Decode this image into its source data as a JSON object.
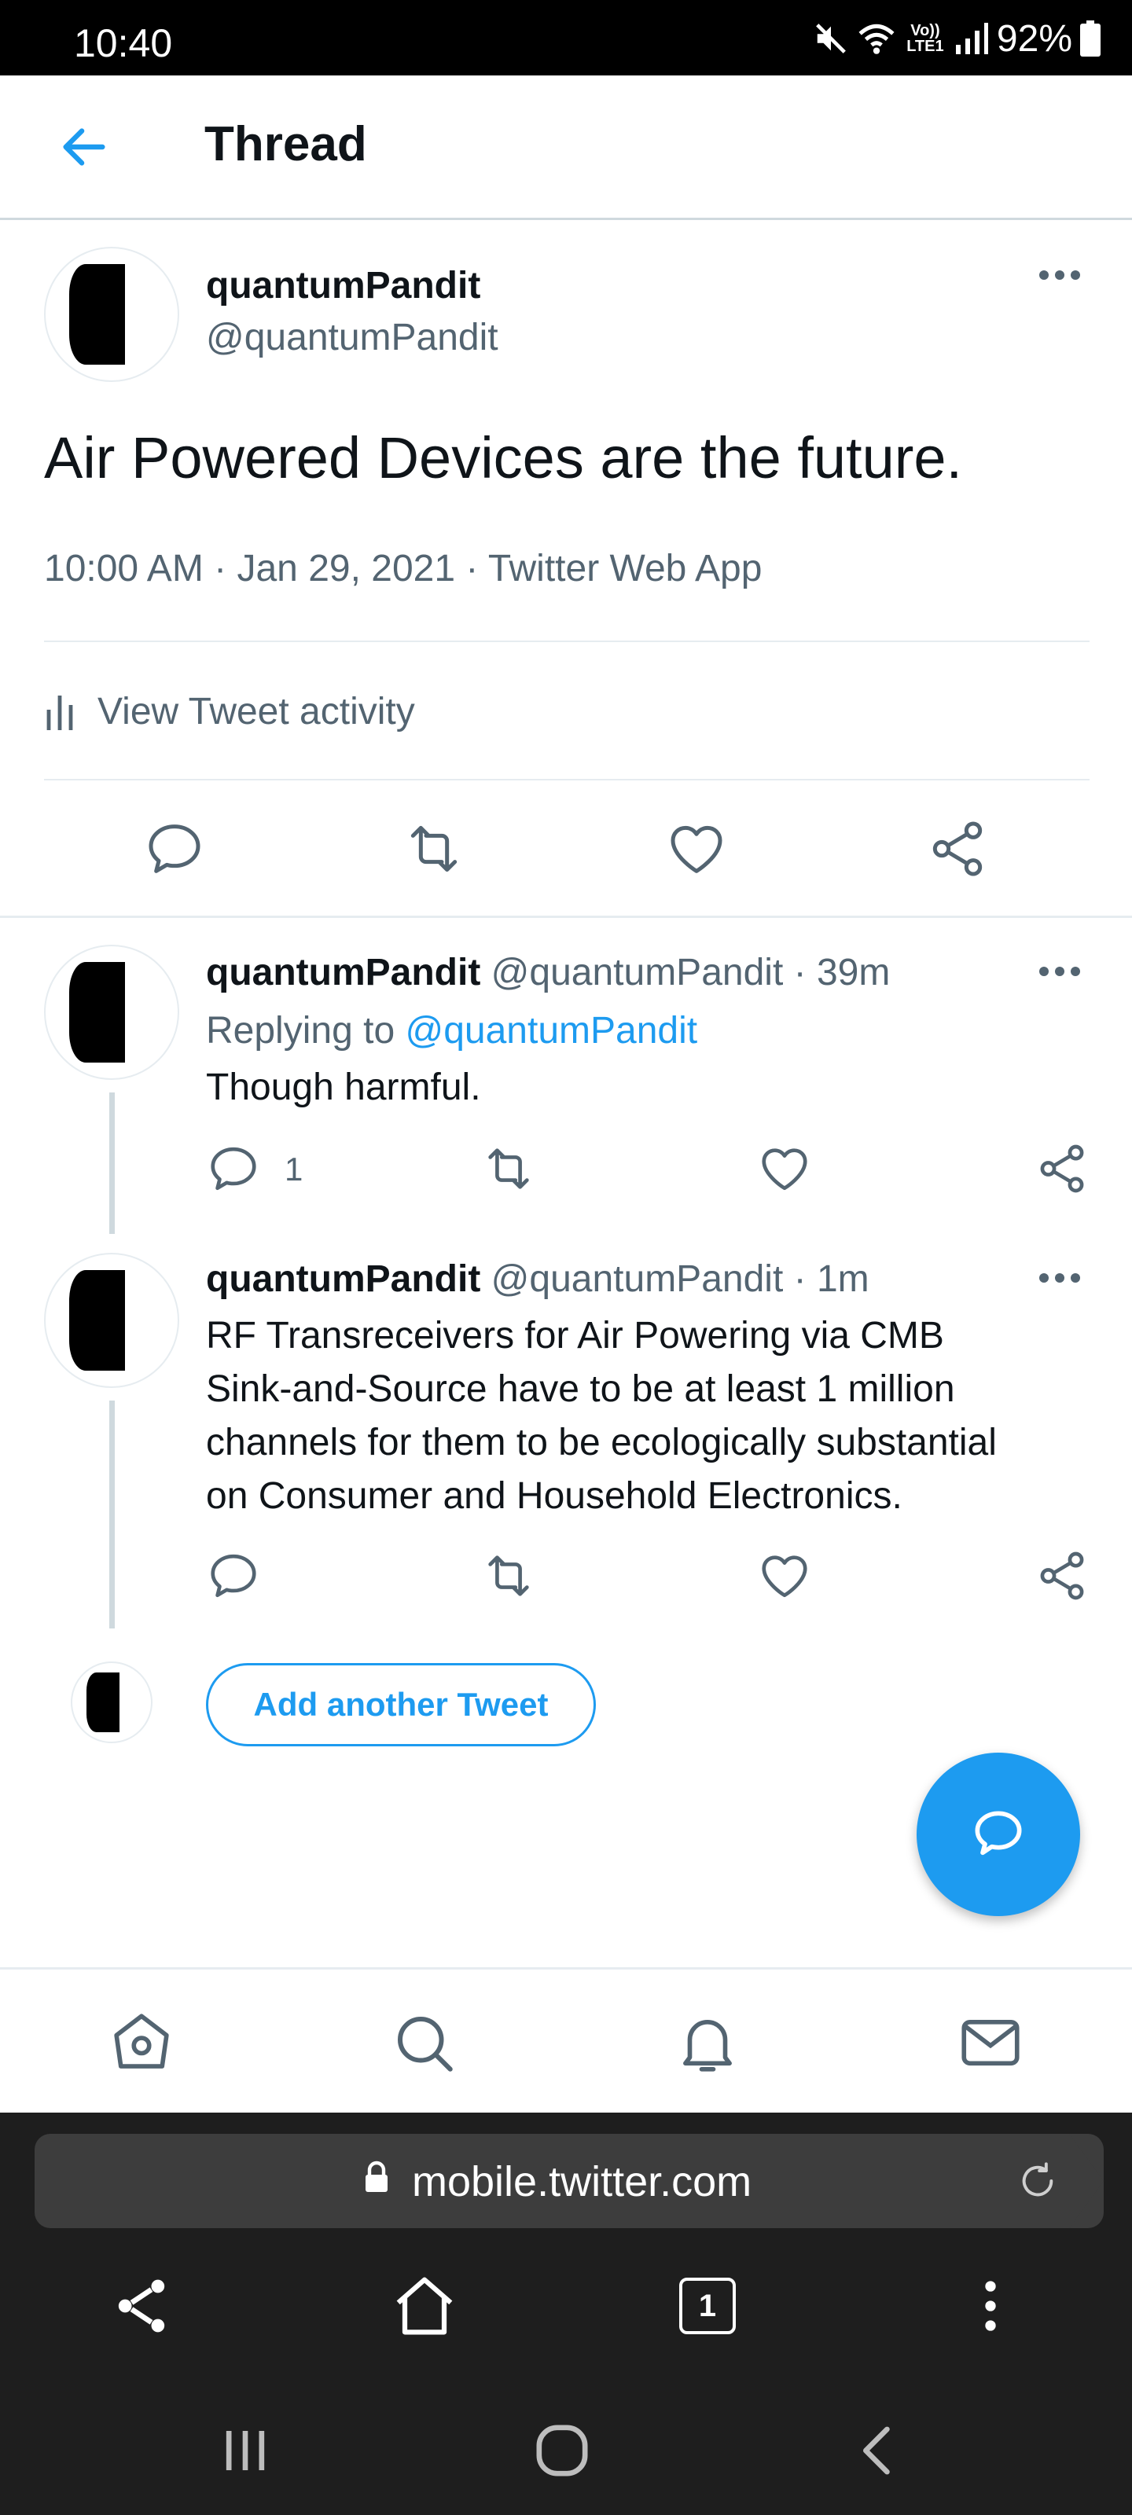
{
  "status_bar": {
    "time": "10:40",
    "battery": "92%",
    "network_label": "Vo)) LTE1",
    "icons": [
      "mute-icon",
      "wifi-icon",
      "signal-icon",
      "battery-icon"
    ]
  },
  "header": {
    "title": "Thread",
    "back_icon": "arrow-left-icon"
  },
  "main_tweet": {
    "name": "quantumPandit",
    "handle": "@quantumPandit",
    "text": "Air Powered Devices are the future.",
    "meta": "10:00 AM · Jan 29, 2021 · Twitter Web App",
    "activity_label": "View Tweet activity",
    "actions": [
      "reply-icon",
      "retweet-icon",
      "like-icon",
      "share-icon"
    ]
  },
  "replies": [
    {
      "name": "quantumPandit",
      "handle": "@quantumPandit",
      "sep": " · ",
      "time": "39m",
      "replying_prefix": "Replying to ",
      "replying_to": "@quantumPandit",
      "text": "Though harmful.",
      "reply_count": "1"
    },
    {
      "name": "quantumPandit",
      "handle": "@quantumPandit",
      "sep": " · ",
      "time": "1m",
      "text_lines": [
        "RF Transreceivers for Air Powering via CMB",
        "Sink-and-Source have to be at least 1 million",
        "channels for them to be ecologically substantial",
        "on Consumer and Household Electronics."
      ]
    }
  ],
  "compose": {
    "add_button_label": "Add another Tweet",
    "fab_icon": "compose-icon"
  },
  "bottom_nav": [
    "home-icon",
    "search-icon",
    "notifications-icon",
    "messages-icon"
  ],
  "browser": {
    "url": "mobile.twitter.com",
    "tab_count": "1"
  },
  "colors": {
    "accent": "#1d9bf0",
    "text": "#0f1419",
    "secondary": "#536471",
    "divider": "#e6ecf0"
  }
}
